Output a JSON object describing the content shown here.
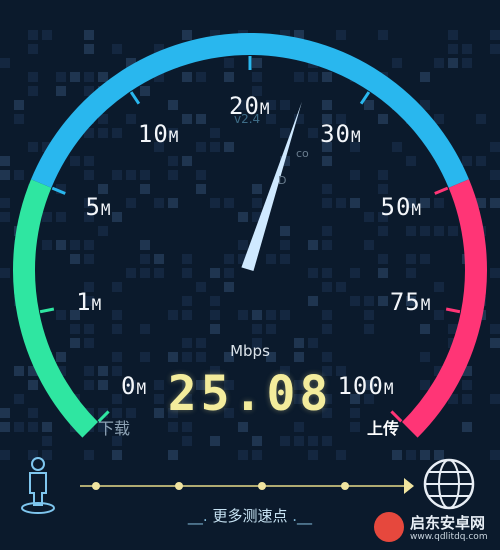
{
  "gauge": {
    "unit": "Mbps",
    "speed": "25.08",
    "speed_value": 25.08,
    "ticks": [
      {
        "num": "0",
        "suffix": "M"
      },
      {
        "num": "1",
        "suffix": "M"
      },
      {
        "num": "5",
        "suffix": "M"
      },
      {
        "num": "10",
        "suffix": "M"
      },
      {
        "num": "20",
        "suffix": "M"
      },
      {
        "num": "30",
        "suffix": "M"
      },
      {
        "num": "50",
        "suffix": "M"
      },
      {
        "num": "75",
        "suffix": "M"
      },
      {
        "num": "100",
        "suffix": "M"
      }
    ],
    "colors": {
      "low": "#2fe6a1",
      "mid": "#29b7ee",
      "high": "#ff3576",
      "needle": "#cfe9ff",
      "speed": "#f3ec9c"
    }
  },
  "labels": {
    "download": "下载",
    "upload": "上传",
    "version": "v2.4"
  },
  "background_text": {
    "a": "co",
    "b": "D"
  },
  "footer": {
    "more_prefix": "__.",
    "more_text": "更多测速点",
    "more_suffix": ".__"
  },
  "icons": {
    "left": "person-location-icon",
    "right": "globe-icon"
  },
  "watermark": {
    "title": "启东安卓网",
    "url": "www.qdlitdq.com"
  }
}
